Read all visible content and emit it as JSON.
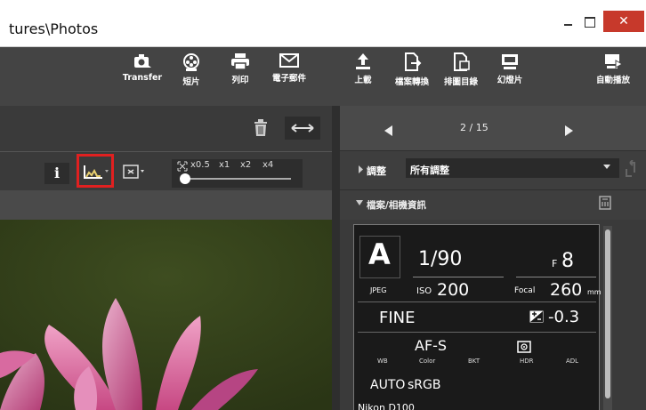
{
  "window": {
    "title": "tures\\Photos",
    "close_glyph": "✕"
  },
  "toolbar": {
    "transfer": "Transfer",
    "photos": "短片",
    "print": "列印",
    "email": "電子郵件",
    "upload": "上載",
    "convert": "檔案轉換",
    "contact_sheet": "排圖目錄",
    "slideshow": "幻燈片",
    "autoplay": "自動播放"
  },
  "left": {
    "zoom_labels": [
      "x0.5",
      "x1",
      "x2",
      "x4"
    ],
    "info_glyph": "i"
  },
  "right": {
    "counter": "2 / 15",
    "adjust_label": "調整",
    "adjust_value": "所有調整",
    "file_info_label": "檔案/相機資訊"
  },
  "camera_info": {
    "mode": "A",
    "shutter": "1/90",
    "f_prefix": "F",
    "aperture": "8",
    "format": "JPEG",
    "iso_label": "ISO",
    "iso": "200",
    "focal_label": "Focal",
    "focal": "260",
    "focal_unit": "mm",
    "quality": "FINE",
    "exposure_comp": "-0.3",
    "af_mode": "AF-S",
    "headers": [
      "WB",
      "Color",
      "BKT",
      "HDR",
      "ADL"
    ],
    "wb": "AUTO",
    "color_space": "sRGB",
    "camera": "Nikon D100"
  },
  "colors": {
    "accent_red": "#e02020",
    "close_red": "#c7392b"
  }
}
